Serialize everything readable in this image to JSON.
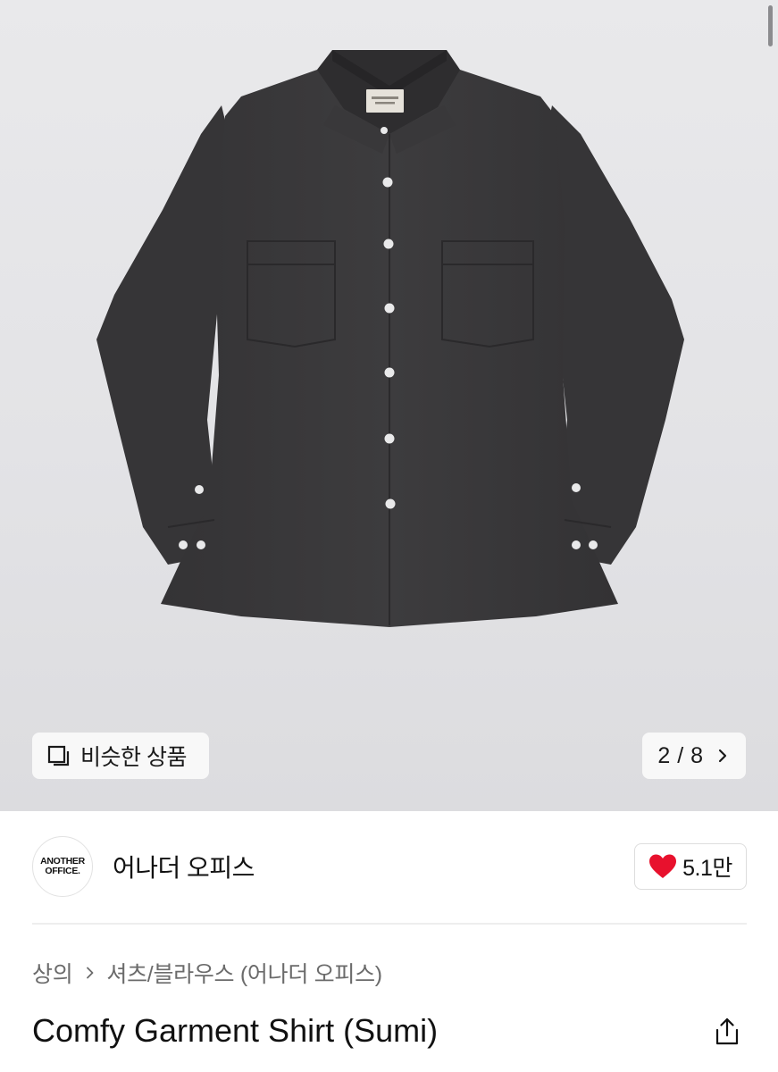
{
  "gallery": {
    "similar_label": "비슷한 상품",
    "pager_text": "2 / 8"
  },
  "brand": {
    "logo_line1": "ANOTHER",
    "logo_line2": "OFFICE.",
    "name": "어나더 오피스",
    "like_count": "5.1만",
    "like_color": "#e8112d"
  },
  "breadcrumb": {
    "category": "상의",
    "subcategory": "셔츠/블라우스 (어나더 오피스)"
  },
  "product": {
    "title": "Comfy Garment Shirt (Sumi)"
  },
  "icons": {
    "similar": "similar-products-icon",
    "pager": "chevron-right-icon",
    "like": "heart-icon",
    "breadcrumb_sep": "chevron-right-icon",
    "share": "share-icon"
  },
  "colors": {
    "shirt": "#3b3a3c",
    "background": "#e6e6e9"
  }
}
